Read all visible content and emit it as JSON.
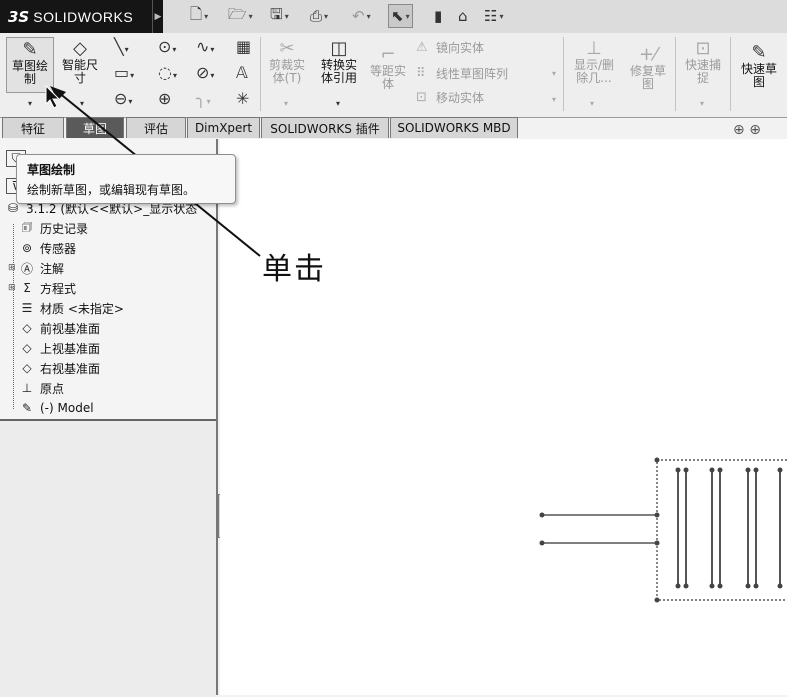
{
  "app": {
    "logo_prefix": "3S",
    "logo_name": "SOLIDWORKS"
  },
  "quick_access": [
    {
      "icon": "new-document-icon"
    },
    {
      "icon": "open-folder-icon"
    },
    {
      "icon": "save-icon"
    },
    {
      "icon": "print-icon"
    },
    {
      "icon": "undo-icon"
    },
    {
      "icon": "select-pointer-icon"
    },
    {
      "icon": "rebuild-icon"
    },
    {
      "icon": "file-properties-icon"
    },
    {
      "icon": "options-icon"
    }
  ],
  "ribbon": {
    "sketch_label": "草图绘\n制",
    "smart_dim_label": "智能尺\n寸",
    "trim_label": "剪裁实\n体(T)",
    "convert_label": "转换实\n体引用",
    "offset_label": "等距实\n体",
    "mirror_label": "镜向实体",
    "linear_pattern_label": "线性草图阵列",
    "move_label": "移动实体",
    "display_delete_label": "显示/删\n除几...",
    "repair_label": "修复草\n图",
    "quick_snap_label": "快速捕\n捉",
    "rapid_sketch_label": "快速草\n图"
  },
  "tabs": [
    "特征",
    "草图",
    "评估",
    "DimXpert",
    "SOLIDWORKS 插件",
    "SOLIDWORKS MBD"
  ],
  "tooltip": {
    "title": "草图绘制",
    "description": "绘制新草图，或编辑现有草图。"
  },
  "tree": {
    "root_label": "3.1.2  (默认<<默认>_显示状态",
    "items": [
      {
        "label": "历史记录",
        "icon": "history-icon"
      },
      {
        "label": "传感器",
        "icon": "sensor-icon"
      },
      {
        "label": "注解",
        "icon": "annotation-icon"
      },
      {
        "label": "方程式",
        "icon": "equation-icon"
      },
      {
        "label": "材质 <未指定>",
        "icon": "material-icon"
      },
      {
        "label": "前视基准面",
        "icon": "plane-icon"
      },
      {
        "label": "上视基准面",
        "icon": "plane-icon"
      },
      {
        "label": "右视基准面",
        "icon": "plane-icon"
      },
      {
        "label": "原点",
        "icon": "origin-icon"
      },
      {
        "label": "(-) Model",
        "icon": "sketch-icon"
      }
    ]
  },
  "callout": {
    "text": "单击"
  }
}
